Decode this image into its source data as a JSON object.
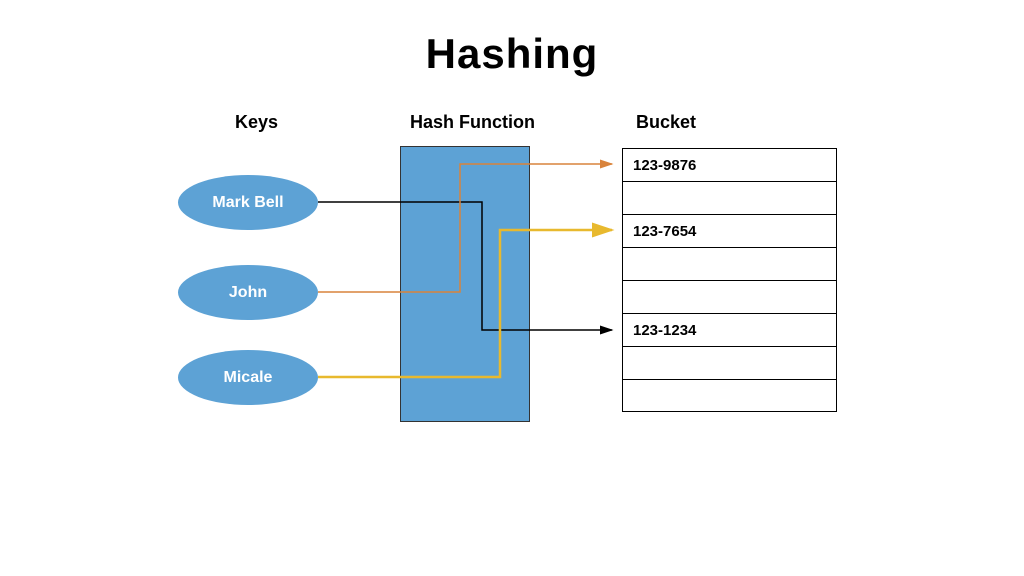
{
  "title": "Hashing",
  "headers": {
    "keys": "Keys",
    "hashFunction": "Hash Function",
    "bucket": "Bucket"
  },
  "keys": [
    "Mark Bell",
    "John",
    "Micale"
  ],
  "buckets": [
    "123-9876",
    "",
    "123-7654",
    "",
    "",
    "123-1234",
    "",
    ""
  ],
  "mappings": [
    {
      "from": "Mark Bell",
      "to": "123-1234",
      "color": "#000000"
    },
    {
      "from": "John",
      "to": "123-9876",
      "color": "#d9833b"
    },
    {
      "from": "Micale",
      "to": "123-7654",
      "color": "#e8b92e"
    }
  ]
}
